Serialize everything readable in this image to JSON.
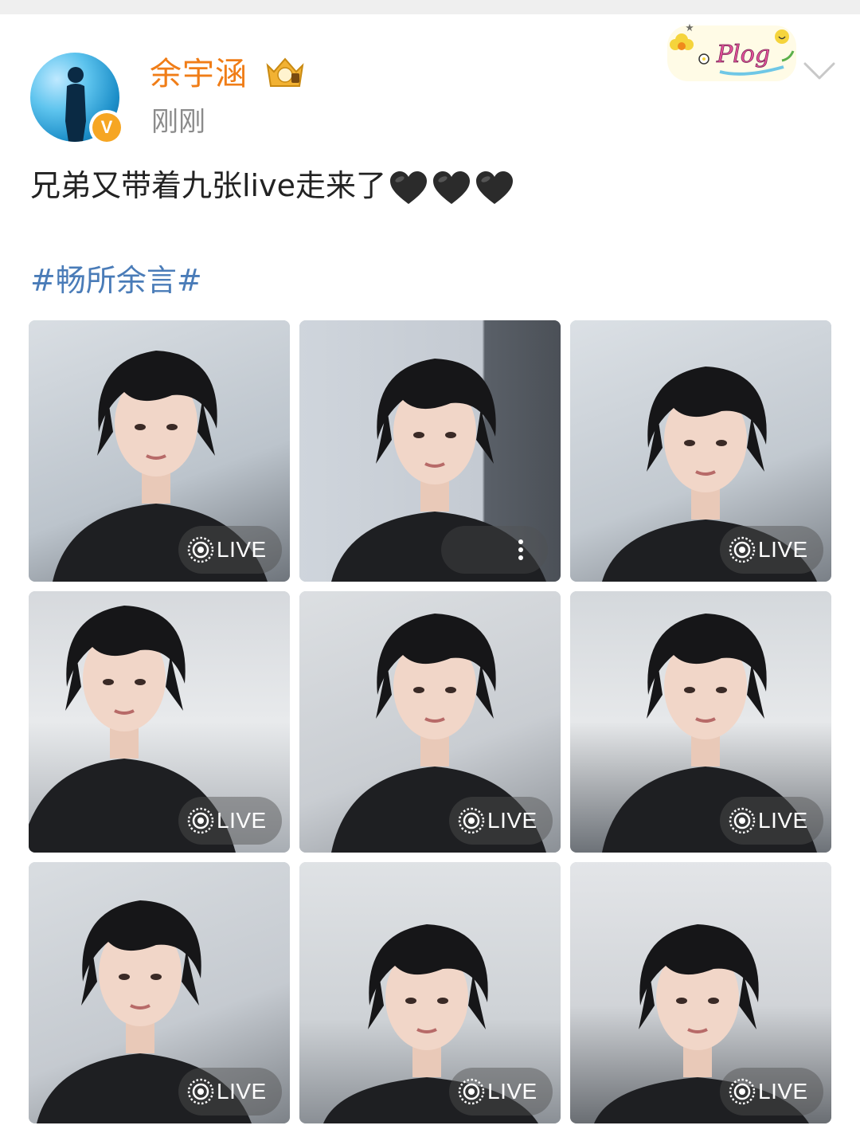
{
  "post": {
    "username": "余宇涵",
    "time": "刚刚",
    "text": "兄弟又带着九张live走来了",
    "hearts": [
      "black-heart",
      "black-heart",
      "black-heart"
    ],
    "topic": "#畅所余言#",
    "sticker_text": "Plog"
  },
  "colors": {
    "username": "#f07d17",
    "topic": "#4a7cb8",
    "verified": "#f6a623"
  },
  "photos": [
    {
      "badge": "LIVE"
    },
    {
      "badge": ""
    },
    {
      "badge": "LIVE"
    },
    {
      "badge": "LIVE"
    },
    {
      "badge": "LIVE"
    },
    {
      "badge": "LIVE"
    },
    {
      "badge": "LIVE"
    },
    {
      "badge": "LIVE"
    },
    {
      "badge": "LIVE"
    }
  ]
}
